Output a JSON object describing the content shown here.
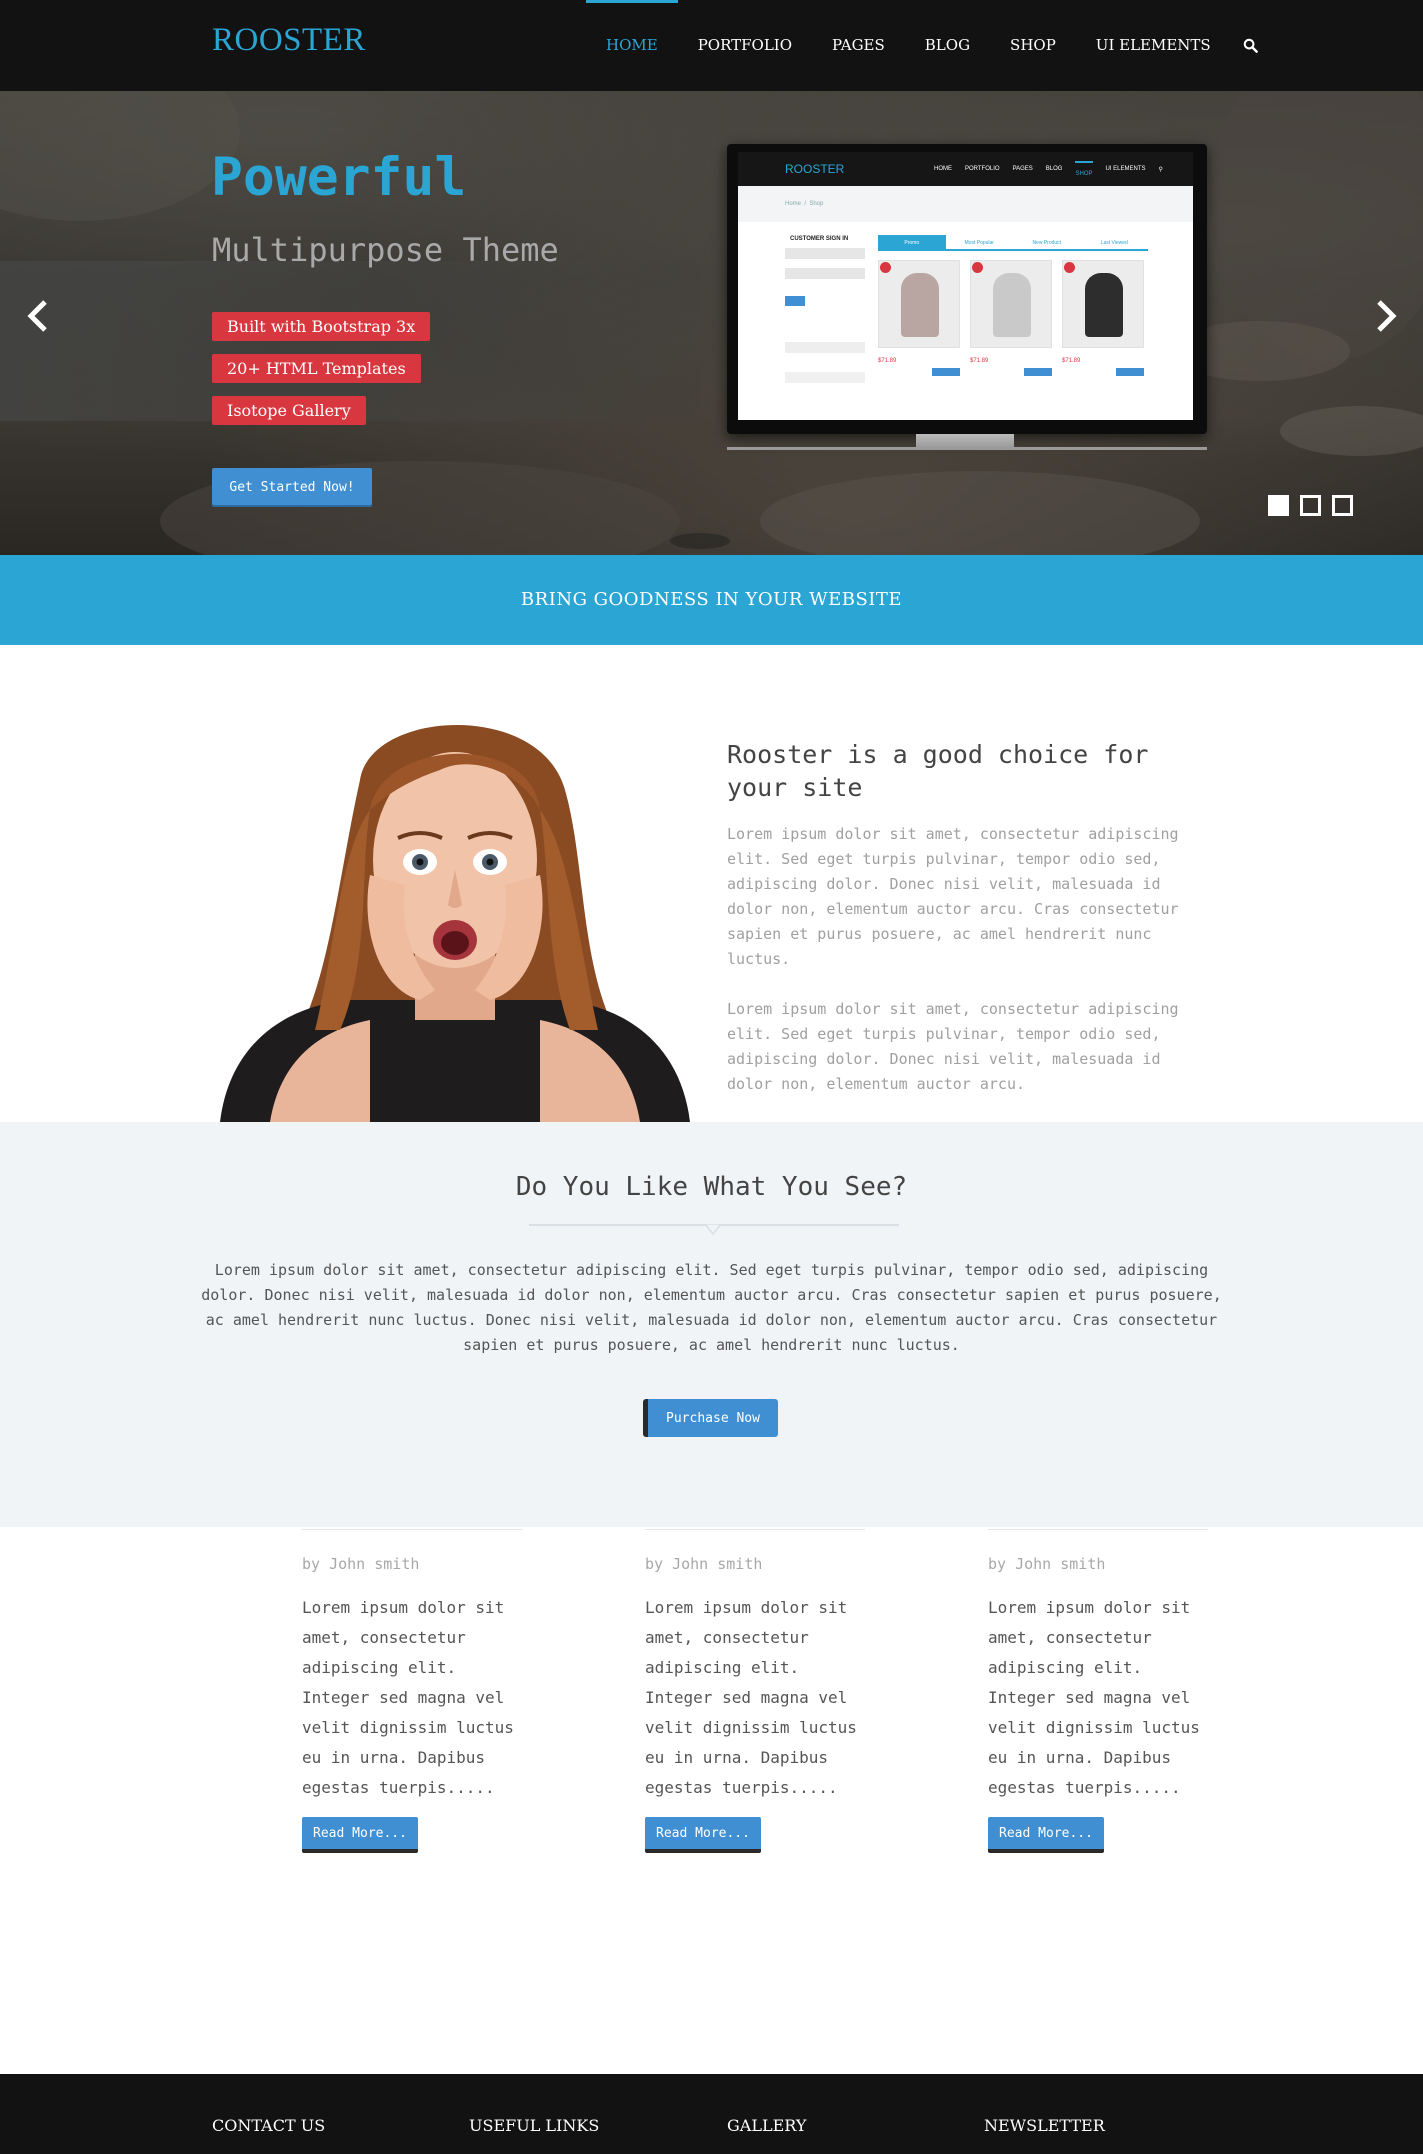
{
  "header": {
    "logo": "ROOSTER",
    "nav": [
      {
        "label": "HOME",
        "active": true
      },
      {
        "label": "PORTFOLIO",
        "active": false
      },
      {
        "label": "PAGES",
        "active": false
      },
      {
        "label": "BLOG",
        "active": false
      },
      {
        "label": "SHOP",
        "active": false
      },
      {
        "label": "UI ELEMENTS",
        "active": false
      }
    ],
    "search_icon": "search-icon"
  },
  "hero": {
    "title": "Powerful",
    "subtitle": "Multipurpose Theme",
    "badges": [
      "Built with Bootstrap 3x",
      "20+ HTML Templates",
      "Isotope Gallery"
    ],
    "cta": "Get Started Now!",
    "prev_icon": "chevron-left-icon",
    "next_icon": "chevron-right-icon",
    "slides_total": 3,
    "active_slide": 1
  },
  "banner": {
    "text": "BRING GOODNESS IN YOUR WEBSITE"
  },
  "about": {
    "heading": "Rooster is a good choice for your site",
    "paragraphs": [
      "Lorem ipsum dolor sit amet, consectetur adipiscing elit. Sed eget turpis pulvinar, tempor odio sed, adipiscing dolor. Donec nisi velit, malesuada id dolor non, elementum auctor arcu. Cras consectetur sapien et purus posuere, ac amel hendrerit nunc luctus.",
      "Lorem ipsum dolor sit amet, consectetur adipiscing elit. Sed eget turpis pulvinar, tempor odio sed, adipiscing dolor. Donec nisi velit, malesuada id dolor non, elementum auctor arcu."
    ]
  },
  "cta_section": {
    "title": "Do You Like What You See?",
    "text": "Lorem ipsum dolor sit amet, consectetur adipiscing elit. Sed eget turpis pulvinar, tempor odio sed, adipiscing dolor. Donec nisi velit, malesuada id dolor non, elementum auctor arcu. Cras consectetur sapien et purus posuere, ac amel hendrerit nunc luctus. Donec nisi velit, malesuada id dolor non, elementum auctor arcu. Cras consectetur sapien et purus posuere, ac amel hendrerit nunc luctus.",
    "button": "Purchase Now"
  },
  "posts": [
    {
      "author": "by John smith",
      "excerpt": "Lorem ipsum dolor sit amet, consectetur adipiscing elit. Integer sed magna vel velit dignissim luctus eu in urna. Dapibus egestas tuerpis.....",
      "button": "Read More..."
    },
    {
      "author": "by John smith",
      "excerpt": "Lorem ipsum dolor sit amet, consectetur adipiscing elit. Integer sed magna vel velit dignissim luctus eu in urna. Dapibus egestas tuerpis.....",
      "button": "Read More..."
    },
    {
      "author": "by John smith",
      "excerpt": "Lorem ipsum dolor sit amet, consectetur adipiscing elit. Integer sed magna vel velit dignissim luctus eu in urna. Dapibus egestas tuerpis.....",
      "button": "Read More..."
    }
  ],
  "footer": {
    "headings": [
      "CONTACT US",
      "USEFUL LINKS",
      "GALLERY",
      "NEWSLETTER"
    ]
  },
  "colors": {
    "accent": "#2ba6d4",
    "badge": "#d9373f",
    "button": "#3f8fd2",
    "dark": "#121212"
  }
}
